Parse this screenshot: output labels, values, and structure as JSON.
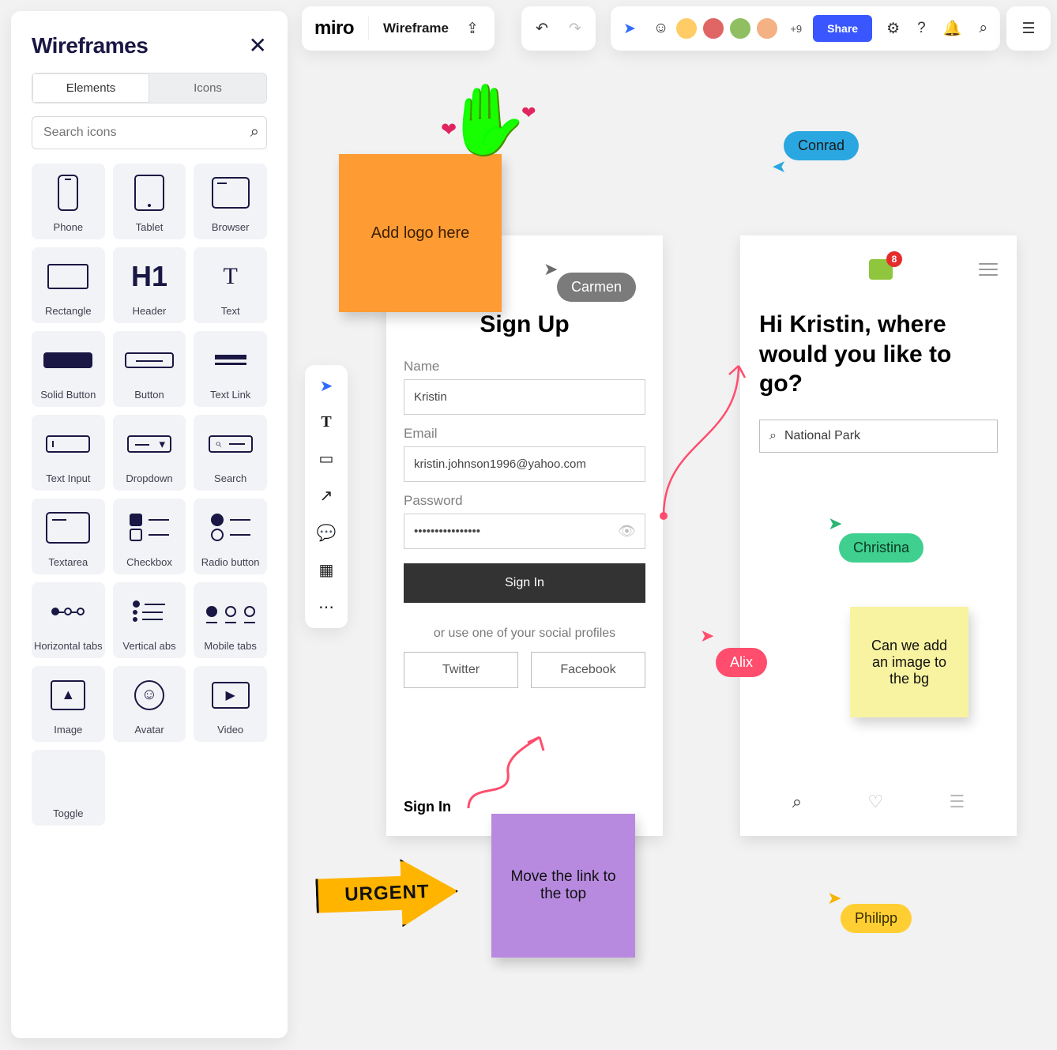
{
  "sidebar": {
    "title": "Wireframes",
    "tabs": {
      "elements": "Elements",
      "icons": "Icons"
    },
    "search_placeholder": "Search icons",
    "tiles": {
      "phone": "Phone",
      "tablet": "Tablet",
      "browser": "Browser",
      "rectangle": "Rectangle",
      "header": "Header",
      "text": "Text",
      "solid_button": "Solid Button",
      "button": "Button",
      "text_link": "Text Link",
      "text_input": "Text Input",
      "dropdown": "Dropdown",
      "search": "Search",
      "textarea": "Textarea",
      "checkbox": "Checkbox",
      "radio": "Radio button",
      "htabs": "Horizontal tabs",
      "vtabs": "Vertical abs",
      "mtabs": "Mobile tabs",
      "image": "Image",
      "avatar": "Avatar",
      "video": "Video",
      "toggle": "Toggle"
    }
  },
  "toolbar": {
    "brand": "miro",
    "board_name": "Wireframe",
    "avatar_overflow": "+9",
    "share": "Share"
  },
  "cursors": {
    "conrad": "Conrad",
    "carmen": "Carmen",
    "alix": "Alix",
    "christina": "Christina",
    "philipp": "Philipp"
  },
  "stickies": {
    "orange": "Add logo here",
    "purple": "Move the link to the top",
    "yellow": "Can we add an image to the bg"
  },
  "urgent_label": "URGENT",
  "signup": {
    "title": "Sign Up",
    "name_label": "Name",
    "name_value": "Kristin",
    "email_label": "Email",
    "email_value": "kristin.johnson1996@yahoo.com",
    "password_label": "Password",
    "password_value": "••••••••••••••••",
    "submit": "Sign In",
    "or": "or use one of your social profiles",
    "twitter": "Twitter",
    "facebook": "Facebook",
    "signin": "Sign In"
  },
  "travel": {
    "badge_count": "8",
    "heading": "Hi Kristin, where would you like to go?",
    "search_value": "National Park"
  }
}
